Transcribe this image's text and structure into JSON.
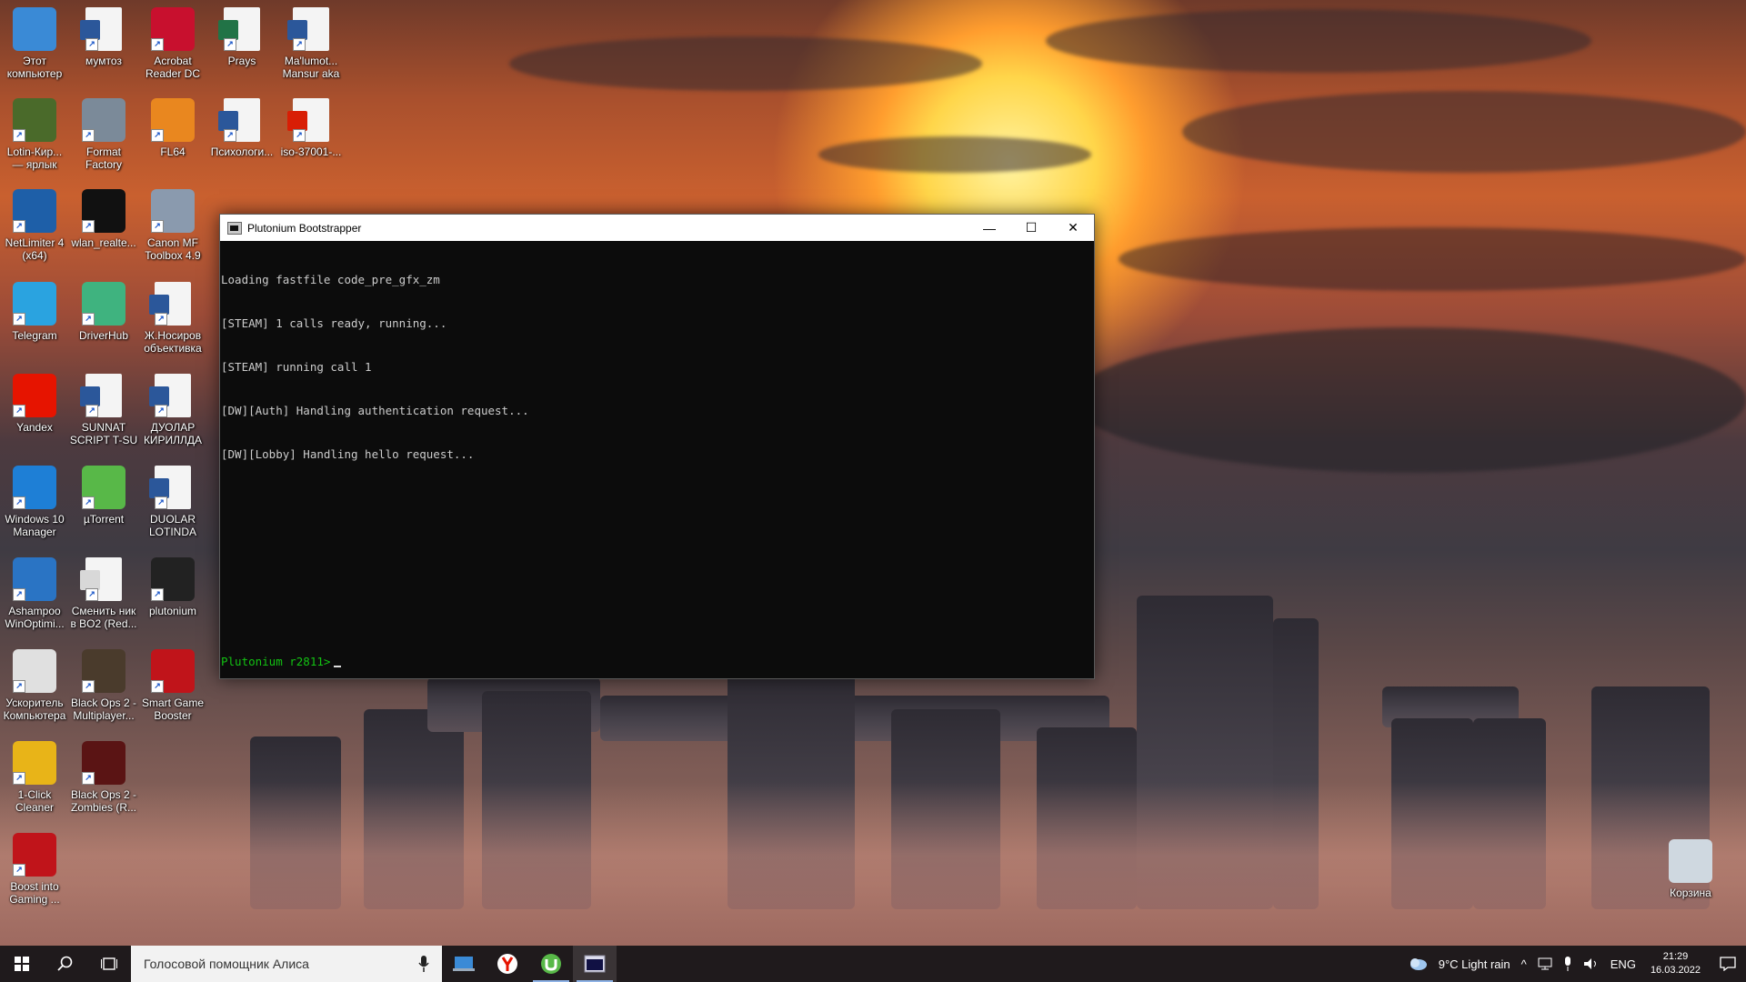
{
  "desktop": {
    "icons": [
      {
        "label": "Этот\nкомпьютер",
        "icon": "computer-icon",
        "color": "#3a8ad6"
      },
      {
        "label": "мумтоз",
        "icon": "word-document-icon",
        "color": "#2b579a"
      },
      {
        "label": "Acrobat\nReader DC",
        "icon": "acrobat-icon",
        "color": "#c8102e"
      },
      {
        "label": "Prays",
        "icon": "excel-document-icon",
        "color": "#217346"
      },
      {
        "label": "Ma'lumot...\nMansur aka",
        "icon": "word-document-icon",
        "color": "#2b579a"
      },
      {
        "label": "Lotin-Кир...\n— ярлык",
        "icon": "lotin-kiril-icon",
        "color": "#4a6a2a"
      },
      {
        "label": "Format\nFactory",
        "icon": "format-factory-icon",
        "color": "#7b8a99"
      },
      {
        "label": "FL64",
        "icon": "fl-studio-icon",
        "color": "#e9871f"
      },
      {
        "label": "Психологи...",
        "icon": "word-document-icon",
        "color": "#2b579a"
      },
      {
        "label": "iso-37001-...",
        "icon": "pdf-document-icon",
        "color": "#d81e05"
      },
      {
        "label": "NetLimiter 4\n(x64)",
        "icon": "netlimiter-icon",
        "color": "#1e5fa8"
      },
      {
        "label": "wlan_realte...",
        "icon": "7zip-archive-icon",
        "color": "#111111"
      },
      {
        "label": "Canon MF\nToolbox 4.9",
        "icon": "canon-toolbox-icon",
        "color": "#8a9aae"
      },
      {
        "label": "Telegram",
        "icon": "telegram-icon",
        "color": "#2aa3e0"
      },
      {
        "label": "DriverHub",
        "icon": "driverhub-icon",
        "color": "#3fb37f"
      },
      {
        "label": "Ж.Носиров\nобъективка",
        "icon": "word-document-icon",
        "color": "#2b579a"
      },
      {
        "label": "Yandex",
        "icon": "yandex-browser-icon",
        "color": "#e61400"
      },
      {
        "label": "SUNNAT\nSCRIPT T-SU",
        "icon": "word-document-icon",
        "color": "#2b579a"
      },
      {
        "label": "ДУОЛАР\nКИРИЛЛДА",
        "icon": "word-document-icon",
        "color": "#2b579a"
      },
      {
        "label": "Windows 10\nManager",
        "icon": "windows10-manager-icon",
        "color": "#1e7fd6"
      },
      {
        "label": "µTorrent",
        "icon": "utorrent-icon",
        "color": "#58b848"
      },
      {
        "label": "DUOLAR\nLOTINDA",
        "icon": "word-document-icon",
        "color": "#2b579a"
      },
      {
        "label": "Ashampoo\nWinOptimi...",
        "icon": "ashampoo-icon",
        "color": "#2a74c4"
      },
      {
        "label": "Сменить ник\nв BO2 (Red...",
        "icon": "file-icon",
        "color": "#d8d8d8"
      },
      {
        "label": "plutonium",
        "icon": "plutonium-icon",
        "color": "#222222"
      },
      {
        "label": "Ускоритель\nКомпьютера",
        "icon": "speedometer-icon",
        "color": "#e0e0e0"
      },
      {
        "label": "Black Ops 2 -\nMultiplayer...",
        "icon": "black-ops-icon",
        "color": "#4a3b2c"
      },
      {
        "label": "Smart Game\nBooster",
        "icon": "game-booster-icon",
        "color": "#c0141a"
      },
      {
        "label": "1-Click\nCleaner",
        "icon": "broom-icon",
        "color": "#e8b418"
      },
      {
        "label": "Black Ops 2 -\nZombies (R...",
        "icon": "black-ops-icon",
        "color": "#5a1414"
      },
      {
        "label": "Boost into\nGaming ...",
        "icon": "game-booster-icon",
        "color": "#c0141a"
      },
      {
        "label": "Корзина",
        "icon": "recycle-bin-icon",
        "color": "#cfd8e0"
      }
    ]
  },
  "window": {
    "title": "Plutonium Bootstrapper",
    "minimize": "—",
    "maximize": "☐",
    "close": "✕",
    "console_lines": [
      "Loading fastfile code_pre_gfx_zm",
      "[STEAM] 1 calls ready, running...",
      "[STEAM] running call 1",
      "[DW][Auth] Handling authentication request...",
      "[DW][Lobby] Handling hello request..."
    ],
    "prompt": "Plutonium r2811>"
  },
  "taskbar": {
    "search_placeholder": "Голосовой помощник Алиса",
    "weather": "9°C  Light rain",
    "language": "ENG",
    "time": "21:29",
    "date": "16.03.2022"
  }
}
